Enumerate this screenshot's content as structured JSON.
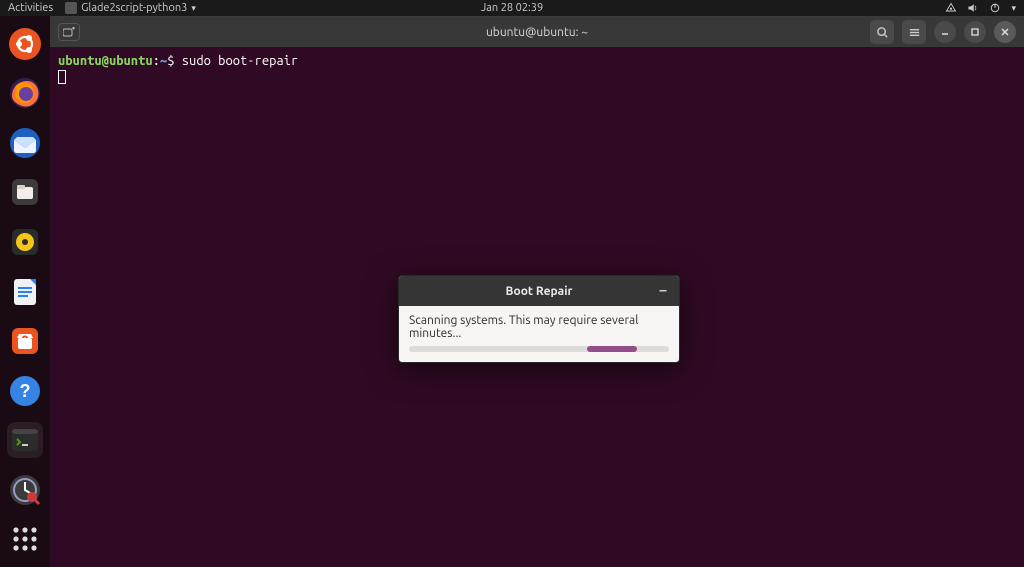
{
  "topbar": {
    "activities": "Activities",
    "app_name": "Glade2script-python3",
    "clock": "Jan 28  02:39"
  },
  "launcher": {
    "items": [
      {
        "name": "ubuntu-dash"
      },
      {
        "name": "firefox"
      },
      {
        "name": "thunderbird"
      },
      {
        "name": "files"
      },
      {
        "name": "rhythmbox"
      },
      {
        "name": "libreoffice-writer"
      },
      {
        "name": "software"
      },
      {
        "name": "help"
      },
      {
        "name": "terminal"
      },
      {
        "name": "boot-repair"
      }
    ]
  },
  "terminal": {
    "title": "ubuntu@ubuntu: ~",
    "prompt_user": "ubuntu@ubuntu",
    "prompt_path": "~",
    "command": "sudo boot-repair"
  },
  "dialog": {
    "title": "Boot Repair",
    "message": "Scanning systems. This may require several minutes..."
  },
  "colors": {
    "terminal_bg": "#300a24",
    "accent": "#e95420",
    "progress": "#924d8b"
  }
}
